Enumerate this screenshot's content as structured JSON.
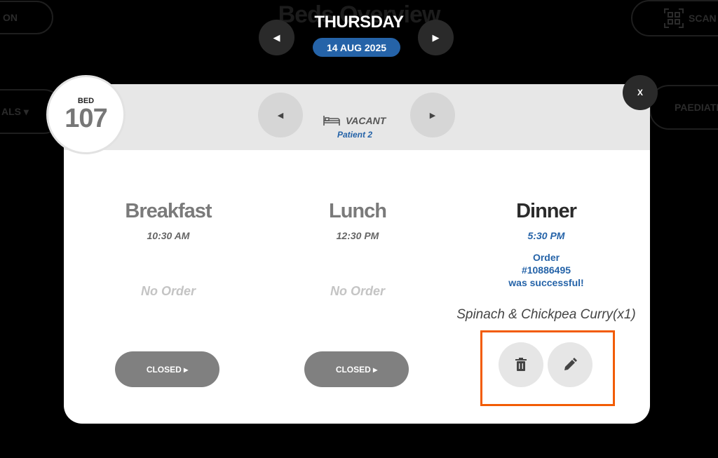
{
  "background": {
    "page_title": "Beds Overview",
    "left_top_pill": "ON",
    "left_mid_pill": "ALS ▾",
    "scan_label": "SCAN",
    "ward_label": "PAEDIATR"
  },
  "date_nav": {
    "day": "THURSDAY",
    "date": "14 AUG 2025",
    "prev_icon": "◀",
    "next_icon": "▶"
  },
  "bed": {
    "label": "BED",
    "number": "107",
    "status": "VACANT",
    "patient": "Patient 2",
    "prev_icon": "◀",
    "next_icon": "▶",
    "close_label": "X"
  },
  "meals": [
    {
      "name": "Breakfast",
      "time": "10:30 AM",
      "status": "No Order",
      "button": "CLOSED ▸"
    },
    {
      "name": "Lunch",
      "time": "12:30 PM",
      "status": "No Order",
      "button": "CLOSED ▸"
    },
    {
      "name": "Dinner",
      "time": "5:30 PM",
      "order_message": [
        "Order",
        "#10886495",
        "was successful!"
      ],
      "item": "Spinach & Chickpea Curry(x1)"
    }
  ],
  "colors": {
    "accent": "#2563a8",
    "highlight": "#f25c05",
    "button_grey": "#808080"
  },
  "icons": {
    "bed": "bed-icon",
    "delete": "trash-icon",
    "edit": "pencil-icon",
    "scan": "qr-code-icon"
  }
}
